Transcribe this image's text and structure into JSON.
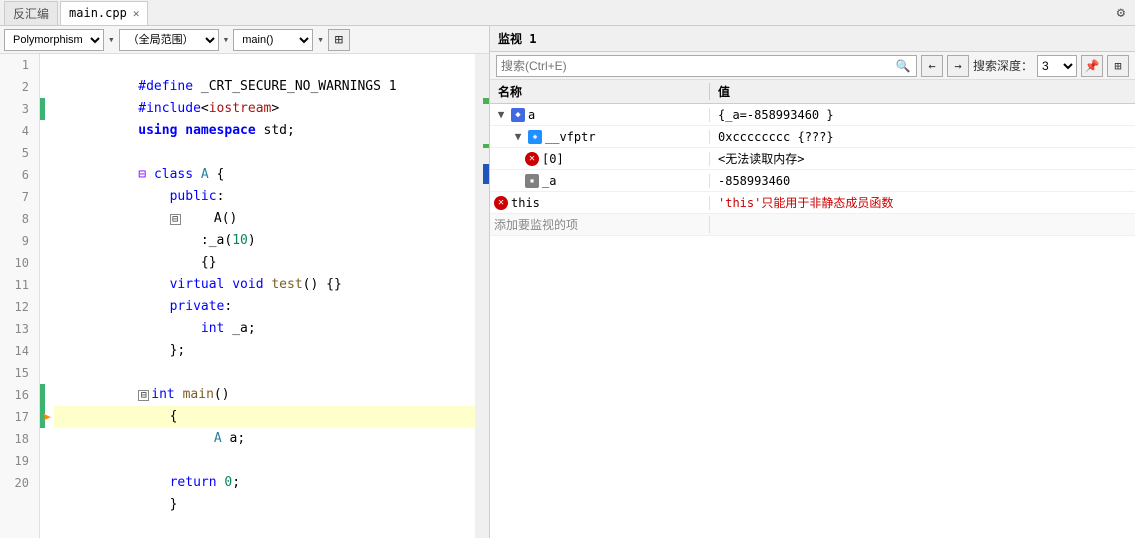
{
  "tabs": [
    {
      "label": "反汇编",
      "active": false,
      "closeable": false
    },
    {
      "label": "main.cpp",
      "active": true,
      "closeable": true
    }
  ],
  "editor": {
    "toolbar": {
      "dropdown1": "Polymorphism",
      "dropdown2": "（全局范围）",
      "dropdown3": "main()"
    },
    "lines": [
      {
        "num": 1,
        "code": "#define _CRT_SECURE_NO_WARNINGS 1",
        "indent": false,
        "green": false
      },
      {
        "num": 2,
        "code": "#include<iostream>",
        "indent": false,
        "green": false
      },
      {
        "num": 3,
        "code": "using namespace std;",
        "indent": false,
        "green": true
      },
      {
        "num": 4,
        "code": "",
        "indent": false,
        "green": false
      },
      {
        "num": 5,
        "code": "class A {",
        "indent": false,
        "green": false
      },
      {
        "num": 6,
        "code": "public:",
        "indent": true,
        "green": false
      },
      {
        "num": 7,
        "code": "A()",
        "indent": true,
        "green": false,
        "collapsible": true
      },
      {
        "num": 8,
        "code": ":_a(10)",
        "indent": true,
        "green": false
      },
      {
        "num": 9,
        "code": "{}",
        "indent": true,
        "green": false
      },
      {
        "num": 10,
        "code": "virtual void test() {}",
        "indent": true,
        "green": false
      },
      {
        "num": 11,
        "code": "private:",
        "indent": true,
        "green": false
      },
      {
        "num": 12,
        "code": "int _a;",
        "indent": true,
        "green": false
      },
      {
        "num": 13,
        "code": "};",
        "indent": true,
        "green": false
      },
      {
        "num": 14,
        "code": "",
        "indent": false,
        "green": false
      },
      {
        "num": 15,
        "code": "int main()",
        "indent": false,
        "green": false,
        "collapsible": true
      },
      {
        "num": 16,
        "code": "{",
        "indent": true,
        "green": true
      },
      {
        "num": 17,
        "code": "A a;",
        "indent": true,
        "green": true,
        "highlighted": true,
        "arrow": true
      },
      {
        "num": 18,
        "code": "",
        "indent": false,
        "green": false
      },
      {
        "num": 19,
        "code": "return 0;",
        "indent": true,
        "green": false
      },
      {
        "num": 20,
        "code": "}",
        "indent": true,
        "green": false
      }
    ]
  },
  "watch": {
    "title": "监视 1",
    "search_placeholder": "搜索(Ctrl+E)",
    "depth_label": "搜索深度：",
    "depth_value": "3",
    "col_name": "名称",
    "col_value": "值",
    "rows": [
      {
        "indent": 0,
        "expanded": true,
        "icon": "obj",
        "name": "a",
        "value": "{_a=-858993460 }",
        "has_children": true
      },
      {
        "indent": 1,
        "expanded": true,
        "icon": "obj-blue",
        "name": "__vfptr",
        "value": "0xcccccccc {???}",
        "has_children": true
      },
      {
        "indent": 2,
        "expanded": false,
        "icon": "error",
        "name": "[0]",
        "value": "<无法读取内存>",
        "has_children": false
      },
      {
        "indent": 2,
        "expanded": false,
        "icon": "ptr",
        "name": "_a",
        "value": "-858993460",
        "has_children": false
      },
      {
        "indent": 0,
        "expanded": false,
        "icon": "error",
        "name": "this",
        "value": "'this'只能用于非静态成员函数",
        "value_red": true,
        "has_children": false
      },
      {
        "indent": 0,
        "add_row": true,
        "name": "添加要监视的项",
        "value": ""
      }
    ]
  }
}
